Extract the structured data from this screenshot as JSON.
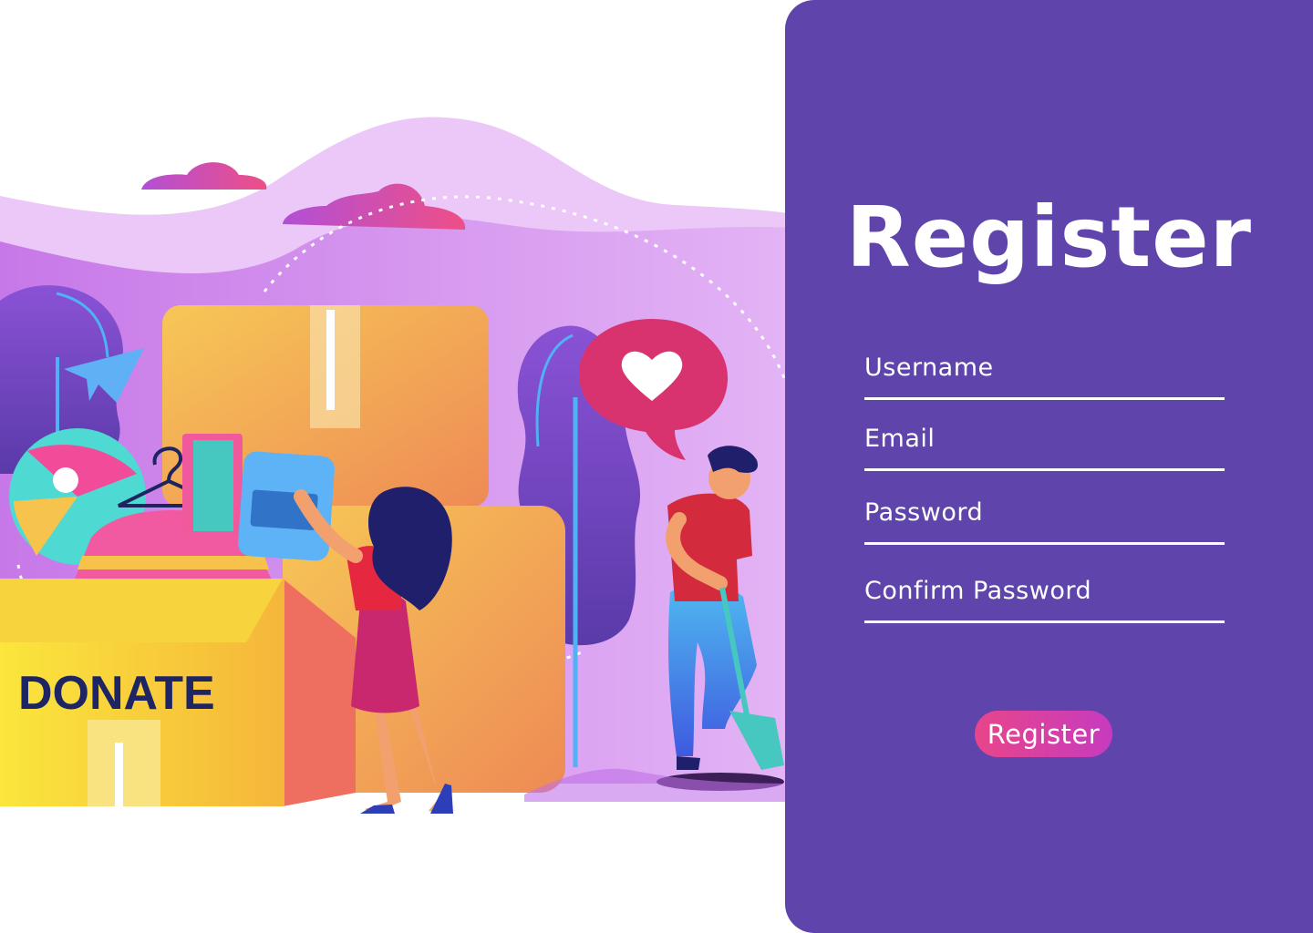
{
  "illustration": {
    "box_label": "DONATE",
    "heart_icon": "heart-icon"
  },
  "form": {
    "title": "Register",
    "fields": [
      {
        "label": "Username",
        "value": ""
      },
      {
        "label": "Email",
        "value": ""
      },
      {
        "label": "Password",
        "value": ""
      },
      {
        "label": "Confirm Password",
        "value": ""
      }
    ],
    "submit_label": "Register"
  },
  "colors": {
    "panel": "#5f45ab",
    "button_start": "#e8458a",
    "button_end": "#c63bbf",
    "text": "#ffffff"
  }
}
